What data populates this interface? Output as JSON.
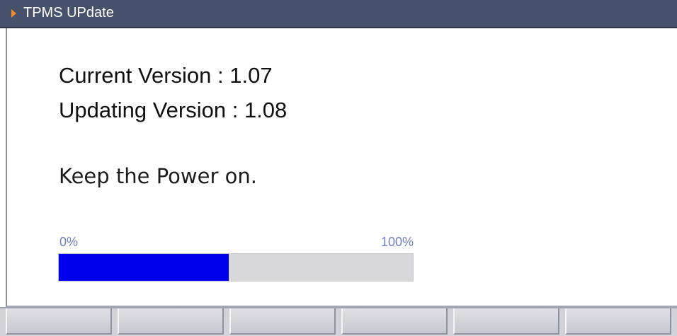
{
  "window": {
    "title": "TPMS UPdate"
  },
  "content": {
    "current_version": "Current Version : 1.07",
    "updating_version": "Updating Version : 1.08",
    "warning": "Keep the Power on."
  },
  "progress": {
    "start_label": "0%",
    "end_label": "100%",
    "value": 0.48,
    "fill_color": "#0000ee",
    "track_color": "#d8d8da"
  },
  "softkeys": [
    {
      "label": ""
    },
    {
      "label": ""
    },
    {
      "label": ""
    },
    {
      "label": ""
    },
    {
      "label": ""
    },
    {
      "label": ""
    }
  ]
}
